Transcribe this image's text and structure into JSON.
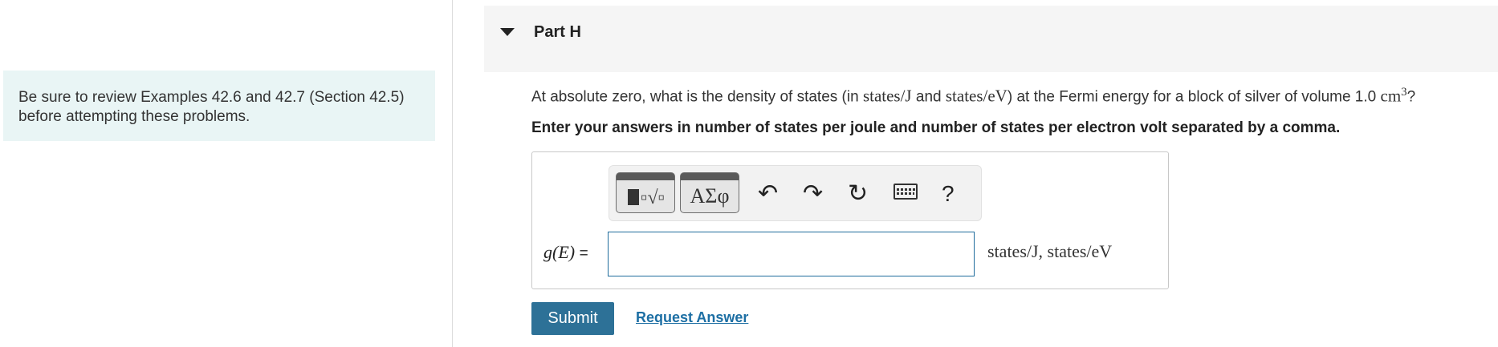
{
  "sidebar_note": {
    "line1": "Be sure to review Examples 42.6 and 42.7 (Section 42.5)",
    "line2": "before attempting these problems."
  },
  "part": {
    "title": "Part H"
  },
  "question": {
    "text_a": "At absolute zero, what is the density of states (in ",
    "unit1": "states/J",
    "text_b": " and ",
    "unit2": "states/eV",
    "text_c": ") at the Fermi energy for a block of silver of volume 1.0 ",
    "volume_unit": "cm",
    "volume_exp": "3",
    "text_d": "?"
  },
  "instruction": "Enter your answers in number of states per joule and number of states per electron volt separated by a comma.",
  "toolbar": {
    "greek_label": "ΑΣφ",
    "templates_icon": "templates-icon",
    "undo_icon": "undo-icon",
    "redo_icon": "redo-icon",
    "reset_icon": "reset-icon",
    "keyboard_icon": "keyboard-icon",
    "help_label": "?"
  },
  "answer": {
    "lhs": "g(E)",
    "equals": "=",
    "value": "",
    "units": "states/J, states/eV"
  },
  "buttons": {
    "submit": "Submit",
    "request_answer": "Request Answer"
  }
}
